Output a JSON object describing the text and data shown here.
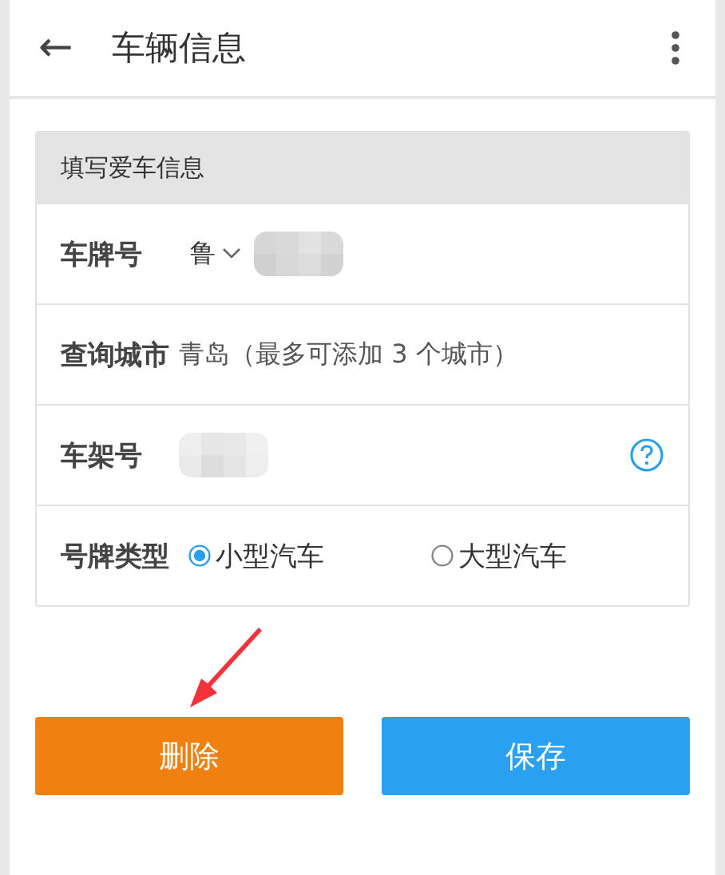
{
  "header": {
    "back_icon": "←",
    "title": "车辆信息"
  },
  "form": {
    "title": "填写爱车信息",
    "rows": [
      {
        "kind": "plate",
        "label": "车牌号",
        "province": "鲁"
      },
      {
        "kind": "text",
        "label": "查询城市",
        "value": "青岛（最多可添加 3 个城市）"
      },
      {
        "kind": "vin",
        "label": "车架号"
      },
      {
        "kind": "radio",
        "label": "号牌类型",
        "options": [
          {
            "label": "小型汽车",
            "selected": true
          },
          {
            "label": "大型汽车",
            "selected": false
          }
        ]
      }
    ]
  },
  "buttons": [
    {
      "label": "删除",
      "color": "#f08010"
    },
    {
      "label": "保存",
      "color": "#2aa0f0"
    }
  ]
}
